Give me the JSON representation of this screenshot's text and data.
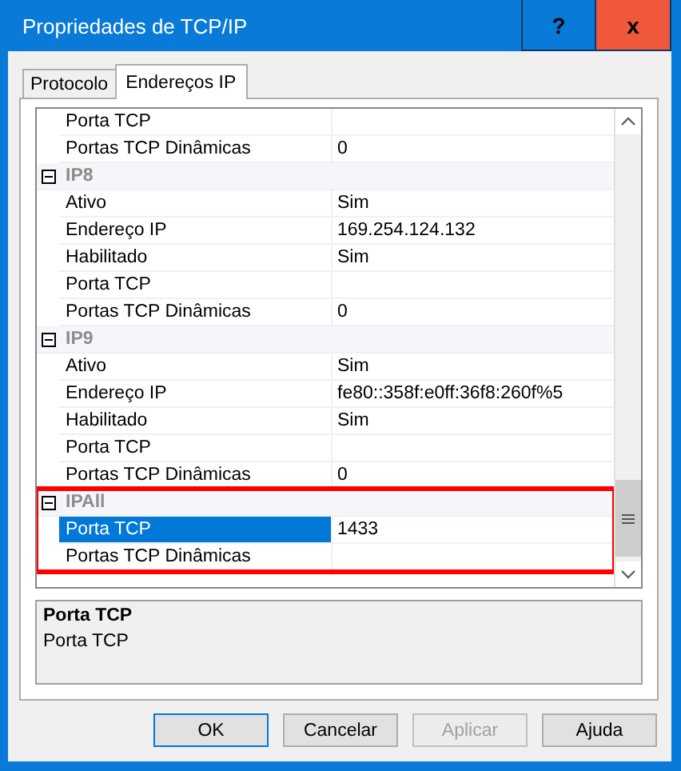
{
  "window": {
    "title": "Propriedades de TCP/IP",
    "help_button": "?",
    "close_button": "x"
  },
  "tabs": [
    {
      "label": "Protocolo",
      "selected": false
    },
    {
      "label": "Endereços IP",
      "selected": true
    }
  ],
  "property_grid": {
    "groups": [
      {
        "rows": [
          {
            "name": "Porta TCP",
            "value": "",
            "selected": false
          },
          {
            "name": "Portas TCP Dinâmicas",
            "value": "0",
            "selected": false
          }
        ]
      },
      {
        "name": "IP8",
        "expanded": true,
        "highlighted": false,
        "rows": [
          {
            "name": "Ativo",
            "value": "Sim",
            "selected": false
          },
          {
            "name": "Endereço IP",
            "value": "169.254.124.132",
            "selected": false
          },
          {
            "name": "Habilitado",
            "value": "Sim",
            "selected": false
          },
          {
            "name": "Porta TCP",
            "value": "",
            "selected": false
          },
          {
            "name": "Portas TCP Dinâmicas",
            "value": "0",
            "selected": false
          }
        ]
      },
      {
        "name": "IP9",
        "expanded": true,
        "highlighted": false,
        "rows": [
          {
            "name": "Ativo",
            "value": "Sim",
            "selected": false
          },
          {
            "name": "Endereço IP",
            "value": "fe80::358f:e0ff:36f8:260f%5",
            "selected": false
          },
          {
            "name": "Habilitado",
            "value": "Sim",
            "selected": false
          },
          {
            "name": "Porta TCP",
            "value": "",
            "selected": false
          },
          {
            "name": "Portas TCP Dinâmicas",
            "value": "0",
            "selected": false
          }
        ]
      },
      {
        "name": "IPAll",
        "expanded": true,
        "highlighted": true,
        "rows": [
          {
            "name": "Porta TCP",
            "value": "1433",
            "selected": true
          },
          {
            "name": "Portas TCP Dinâmicas",
            "value": "",
            "selected": false
          }
        ]
      }
    ]
  },
  "description": {
    "title": "Porta TCP",
    "text": "Porta TCP"
  },
  "buttons": [
    {
      "label": "OK",
      "default": true,
      "disabled": false
    },
    {
      "label": "Cancelar",
      "default": false,
      "disabled": false
    },
    {
      "label": "Aplicar",
      "default": false,
      "disabled": true
    },
    {
      "label": "Ajuda",
      "default": false,
      "disabled": false
    }
  ]
}
